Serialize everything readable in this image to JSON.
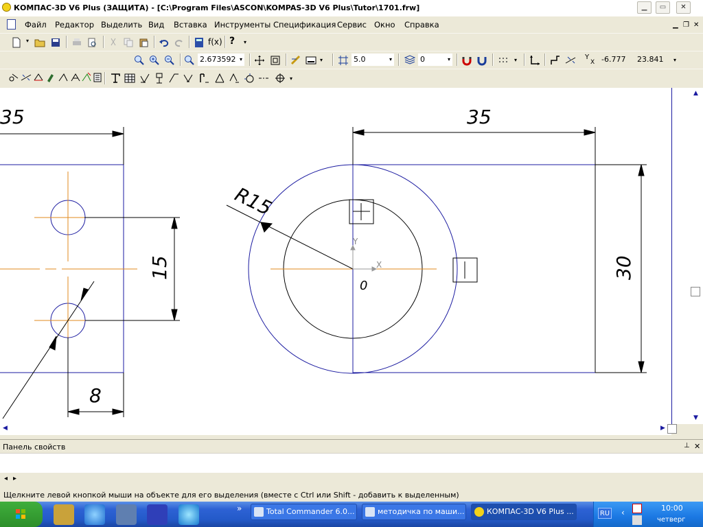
{
  "window": {
    "title": "КОМПАС-3D V6 Plus (ЗАЩИТА) - [C:\\Program Files\\ASCON\\KOMPAS-3D V6 Plus\\Tutor\\1701.frw]",
    "min": "▁",
    "max": "▭",
    "close": "✕"
  },
  "menu": {
    "items": [
      "Файл",
      "Редактор",
      "Выделить",
      "Вид",
      "Вставка",
      "Инструменты",
      "Спецификация",
      "Сервис",
      "Окно",
      "Справка"
    ],
    "mdi_min": "▁",
    "mdi_restore": "❐",
    "mdi_close": "✕"
  },
  "toolbar": {
    "zoom_value": "2.673592",
    "line_width": "5.0",
    "layer": "0",
    "coord_x": "-6.777",
    "coord_y": "23.841",
    "fx_label": "f(x)",
    "help_label": "?"
  },
  "drawing": {
    "dim_top_left": "35",
    "dim_top_right": "35",
    "dim_radius": "R15",
    "dim_holes": "15",
    "dim_width": "8",
    "dim_height": "30",
    "axis_x": "X",
    "axis_y": "Y",
    "origin": "0"
  },
  "panel": {
    "title": "Панель свойств",
    "pin": "📌",
    "close": "✕",
    "prev": "◂",
    "next": "▸"
  },
  "status": {
    "text": "Щелкните левой кнопкой мыши на объекте для его выделения (вместе с Ctrl или Shift - добавить к выделенным)"
  },
  "taskbar": {
    "tasks": [
      "Total Commander 6.0...",
      "методичка по маши...",
      "КОМПАС-3D V6 Plus ..."
    ],
    "more": "»",
    "lang": "RU",
    "time": "10:00",
    "day": "четверг"
  },
  "colors": {
    "outline": "#1a1aa0",
    "axis": "#e08a1e",
    "dim": "#000000"
  }
}
